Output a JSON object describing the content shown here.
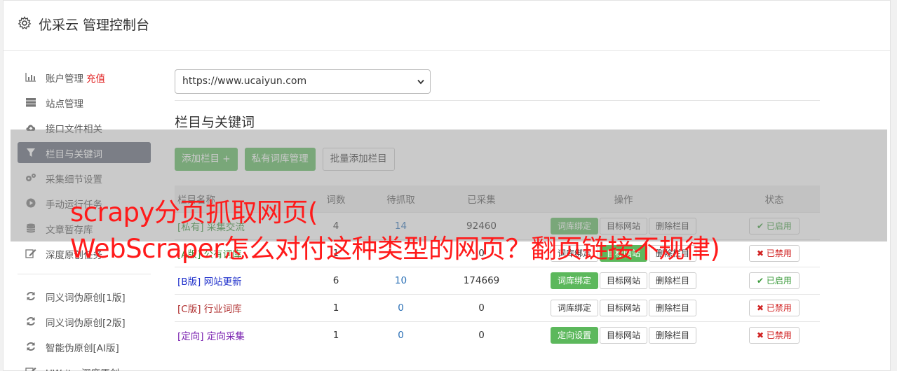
{
  "header": {
    "title": "优采云 管理控制台"
  },
  "sidebar": {
    "items": [
      {
        "label": "账户管理",
        "extra": "充值",
        "icon": "bar-chart-icon"
      },
      {
        "label": "站点管理",
        "icon": "server-icon"
      },
      {
        "label": "接口文件相关",
        "icon": "cloud-upload-icon"
      },
      {
        "label": "栏目与关键词",
        "icon": "filter-icon",
        "active": true
      },
      {
        "label": "采集细节设置",
        "icon": "cogs-icon"
      },
      {
        "label": "手动运行任务",
        "icon": "play-circle-icon"
      },
      {
        "label": "文章暂存库",
        "icon": "database-icon"
      },
      {
        "label": "深度原创任务",
        "icon": "edit-icon"
      }
    ],
    "items2": [
      {
        "label": "同义词伪原创[1版]",
        "icon": "refresh-icon"
      },
      {
        "label": "同义词伪原创[2版]",
        "icon": "refresh-icon"
      },
      {
        "label": "智能伪原创[AI版]",
        "icon": "refresh-icon"
      },
      {
        "label": "UWriter深度原创",
        "icon": "edit-icon"
      }
    ]
  },
  "main": {
    "site_select": "https://www.ucaiyun.com",
    "section_title": "栏目与关键词",
    "buttons": {
      "add": "添加栏目 +",
      "private": "私有词库管理",
      "batch": "批量添加栏目"
    },
    "table": {
      "headers": [
        "栏目名称",
        "词数",
        "待抓取",
        "已采集",
        "操作",
        "状态"
      ],
      "rows": [
        {
          "tag": "[私有]",
          "name": "采集交流",
          "words": "4",
          "pending": "14",
          "collected": "92460",
          "op1": "词库绑定",
          "op2": "目标网站",
          "op3": "删除栏目",
          "status": "已启用"
        },
        {
          "tag": "[A版]",
          "name": "公有词库",
          "words": "1",
          "pending": "",
          "collected": "0",
          "op1": "词库绑定",
          "op2": "目标网站",
          "op3": "删除栏目",
          "status": "已禁用"
        },
        {
          "tag": "[B版]",
          "name": "网站更新",
          "words": "6",
          "pending": "10",
          "collected": "174669",
          "op1": "词库绑定",
          "op2": "目标网站",
          "op3": "删除栏目",
          "status": "已启用"
        },
        {
          "tag": "[C版]",
          "name": "行业词库",
          "words": "1",
          "pending": "0",
          "collected": "0",
          "op1": "词库绑定",
          "op2": "目标网站",
          "op3": "删除栏目",
          "status": "已禁用"
        },
        {
          "tag": "[定向]",
          "name": "定向采集",
          "words": "1",
          "pending": "0",
          "collected": "0",
          "op1": "定向设置",
          "op2": "目标网站",
          "op3": "删除栏目",
          "status": "已禁用"
        }
      ]
    }
  },
  "overlay": {
    "line1": "scrapy分页抓取网页(",
    "line2": "WebScraper怎么对付这种类型的网页？翻页链接不规律)"
  },
  "colors": {
    "accent_green": "#5cb85c",
    "active_sidebar": "#606776",
    "overlay_text": "#ff1a1a"
  }
}
